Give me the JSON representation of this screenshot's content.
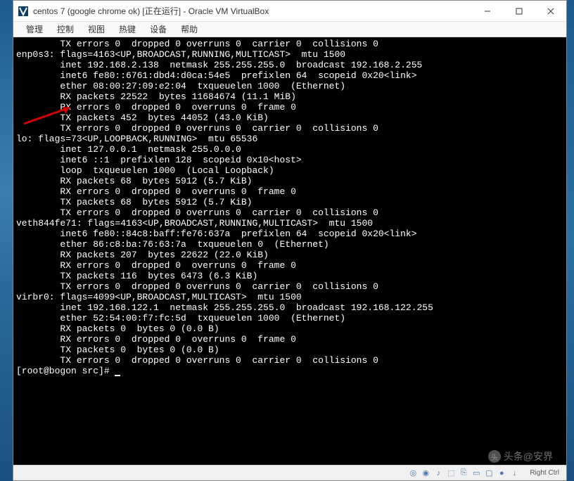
{
  "window": {
    "title": "centos 7 (google chrome ok) [正在运行] - Oracle VM VirtualBox"
  },
  "menubar": {
    "items": [
      "管理",
      "控制",
      "视图",
      "热键",
      "设备",
      "帮助"
    ]
  },
  "terminal": {
    "lines": [
      "        TX errors 0  dropped 0 overruns 0  carrier 0  collisions 0",
      "",
      "enp0s3: flags=4163<UP,BROADCAST,RUNNING,MULTICAST>  mtu 1500",
      "        inet 192.168.2.138  netmask 255.255.255.0  broadcast 192.168.2.255",
      "        inet6 fe80::6761:dbd4:d0ca:54e5  prefixlen 64  scopeid 0x20<link>",
      "        ether 08:00:27:09:e2:04  txqueuelen 1000  (Ethernet)",
      "        RX packets 22522  bytes 11684674 (11.1 MiB)",
      "        RX errors 0  dropped 0  overruns 0  frame 0",
      "        TX packets 452  bytes 44052 (43.0 KiB)",
      "        TX errors 0  dropped 0 overruns 0  carrier 0  collisions 0",
      "",
      "lo: flags=73<UP,LOOPBACK,RUNNING>  mtu 65536",
      "        inet 127.0.0.1  netmask 255.0.0.0",
      "        inet6 ::1  prefixlen 128  scopeid 0x10<host>",
      "        loop  txqueuelen 1000  (Local Loopback)",
      "        RX packets 68  bytes 5912 (5.7 KiB)",
      "        RX errors 0  dropped 0  overruns 0  frame 0",
      "        TX packets 68  bytes 5912 (5.7 KiB)",
      "        TX errors 0  dropped 0 overruns 0  carrier 0  collisions 0",
      "",
      "veth844fe71: flags=4163<UP,BROADCAST,RUNNING,MULTICAST>  mtu 1500",
      "        inet6 fe80::84c8:baff:fe76:637a  prefixlen 64  scopeid 0x20<link>",
      "        ether 86:c8:ba:76:63:7a  txqueuelen 0  (Ethernet)",
      "        RX packets 207  bytes 22622 (22.0 KiB)",
      "        RX errors 0  dropped 0  overruns 0  frame 0",
      "        TX packets 116  bytes 6473 (6.3 KiB)",
      "        TX errors 0  dropped 0 overruns 0  carrier 0  collisions 0",
      "",
      "virbr0: flags=4099<UP,BROADCAST,MULTICAST>  mtu 1500",
      "        inet 192.168.122.1  netmask 255.255.255.0  broadcast 192.168.122.255",
      "        ether 52:54:00:f7:fc:5d  txqueuelen 1000  (Ethernet)",
      "        RX packets 0  bytes 0 (0.0 B)",
      "        RX errors 0  dropped 0  overruns 0  frame 0",
      "        TX packets 0  bytes 0 (0.0 B)",
      "        TX errors 0  dropped 0 overruns 0  carrier 0  collisions 0",
      "",
      "[root@bogon src]# "
    ]
  },
  "statusbar": {
    "host_key": "Right Ctrl"
  },
  "watermark": {
    "text": "头条@安界"
  }
}
